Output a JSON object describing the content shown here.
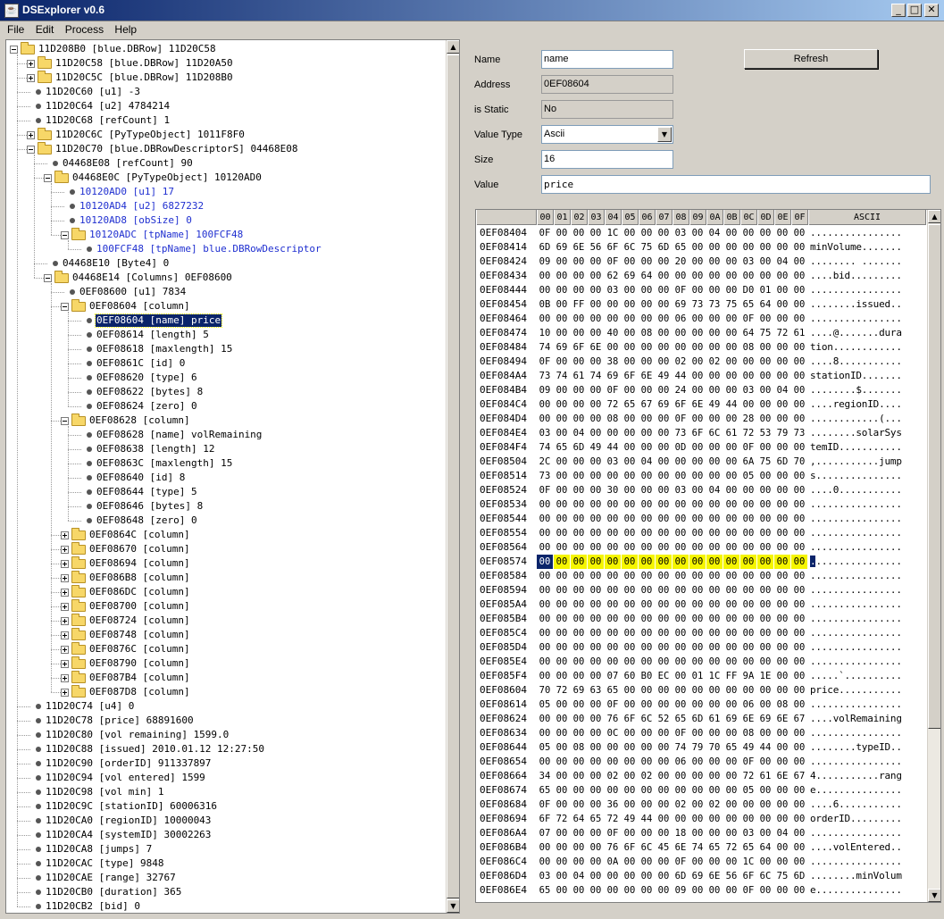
{
  "window": {
    "title": "DSExplorer v0.6",
    "minimize": "_",
    "maximize": "□",
    "close": "✕"
  },
  "menu": [
    "File",
    "Edit",
    "Process",
    "Help"
  ],
  "tree": [
    {
      "d": 0,
      "t": "f",
      "open": true,
      "label": "11D208B0 [blue.DBRow] 11D20C58"
    },
    {
      "d": 1,
      "t": "f",
      "open": false,
      "label": "11D20C58 [blue.DBRow] 11D20A50"
    },
    {
      "d": 1,
      "t": "f",
      "open": false,
      "label": "11D20C5C [blue.DBRow] 11D208B0"
    },
    {
      "d": 1,
      "t": "l",
      "label": "11D20C60 [u1] -3"
    },
    {
      "d": 1,
      "t": "l",
      "label": "11D20C64 [u2] 4784214"
    },
    {
      "d": 1,
      "t": "l",
      "label": "11D20C68 [refCount] 1"
    },
    {
      "d": 1,
      "t": "f",
      "open": false,
      "label": "11D20C6C [PyTypeObject] 1011F8F0"
    },
    {
      "d": 1,
      "t": "f",
      "open": true,
      "label": "11D20C70 [blue.DBRowDescriptorS] 04468E08"
    },
    {
      "d": 2,
      "t": "l",
      "label": "04468E08 [refCount] 90"
    },
    {
      "d": 2,
      "t": "f",
      "open": true,
      "label": "04468E0C [PyTypeObject] 10120AD0"
    },
    {
      "d": 3,
      "t": "l",
      "blue": true,
      "label": "10120AD0 [u1] 17"
    },
    {
      "d": 3,
      "t": "l",
      "blue": true,
      "label": "10120AD4 [u2] 6827232"
    },
    {
      "d": 3,
      "t": "l",
      "blue": true,
      "label": "10120AD8 [obSize] 0"
    },
    {
      "d": 3,
      "t": "f",
      "open": true,
      "blue": true,
      "label": "10120ADC [tpName] 100FCF48"
    },
    {
      "d": 4,
      "t": "l",
      "blue": true,
      "label": "100FCF48 [tpName] blue.DBRowDescriptor"
    },
    {
      "d": 2,
      "t": "l",
      "label": "04468E10 [Byte4] 0"
    },
    {
      "d": 2,
      "t": "f",
      "open": true,
      "label": "04468E14 [Columns] 0EF08600"
    },
    {
      "d": 3,
      "t": "l",
      "label": "0EF08600 [u1] 7834"
    },
    {
      "d": 3,
      "t": "f",
      "open": true,
      "label": "0EF08604 [column]"
    },
    {
      "d": 4,
      "t": "l",
      "sel": true,
      "label": "0EF08604 [name] price"
    },
    {
      "d": 4,
      "t": "l",
      "label": "0EF08614 [length] 5"
    },
    {
      "d": 4,
      "t": "l",
      "label": "0EF08618 [maxlength] 15"
    },
    {
      "d": 4,
      "t": "l",
      "label": "0EF0861C [id] 0"
    },
    {
      "d": 4,
      "t": "l",
      "label": "0EF08620 [type] 6"
    },
    {
      "d": 4,
      "t": "l",
      "label": "0EF08622 [bytes] 8"
    },
    {
      "d": 4,
      "t": "l",
      "label": "0EF08624 [zero] 0"
    },
    {
      "d": 3,
      "t": "f",
      "open": true,
      "label": "0EF08628 [column]"
    },
    {
      "d": 4,
      "t": "l",
      "label": "0EF08628 [name] volRemaining"
    },
    {
      "d": 4,
      "t": "l",
      "label": "0EF08638 [length] 12"
    },
    {
      "d": 4,
      "t": "l",
      "label": "0EF0863C [maxlength] 15"
    },
    {
      "d": 4,
      "t": "l",
      "label": "0EF08640 [id] 8"
    },
    {
      "d": 4,
      "t": "l",
      "label": "0EF08644 [type] 5"
    },
    {
      "d": 4,
      "t": "l",
      "label": "0EF08646 [bytes] 8"
    },
    {
      "d": 4,
      "t": "l",
      "label": "0EF08648 [zero] 0"
    },
    {
      "d": 3,
      "t": "f",
      "open": false,
      "label": "0EF0864C [column]"
    },
    {
      "d": 3,
      "t": "f",
      "open": false,
      "label": "0EF08670 [column]"
    },
    {
      "d": 3,
      "t": "f",
      "open": false,
      "label": "0EF08694 [column]"
    },
    {
      "d": 3,
      "t": "f",
      "open": false,
      "label": "0EF086B8 [column]"
    },
    {
      "d": 3,
      "t": "f",
      "open": false,
      "label": "0EF086DC [column]"
    },
    {
      "d": 3,
      "t": "f",
      "open": false,
      "label": "0EF08700 [column]"
    },
    {
      "d": 3,
      "t": "f",
      "open": false,
      "label": "0EF08724 [column]"
    },
    {
      "d": 3,
      "t": "f",
      "open": false,
      "label": "0EF08748 [column]"
    },
    {
      "d": 3,
      "t": "f",
      "open": false,
      "label": "0EF0876C [column]"
    },
    {
      "d": 3,
      "t": "f",
      "open": false,
      "label": "0EF08790 [column]"
    },
    {
      "d": 3,
      "t": "f",
      "open": false,
      "label": "0EF087B4 [column]"
    },
    {
      "d": 3,
      "t": "f",
      "open": false,
      "label": "0EF087D8 [column]"
    },
    {
      "d": 1,
      "t": "l",
      "label": "11D20C74 [u4] 0"
    },
    {
      "d": 1,
      "t": "l",
      "label": "11D20C78 [price] 68891600"
    },
    {
      "d": 1,
      "t": "l",
      "label": "11D20C80 [vol remaining] 1599.0"
    },
    {
      "d": 1,
      "t": "l",
      "label": "11D20C88 [issued] 2010.01.12 12:27:50"
    },
    {
      "d": 1,
      "t": "l",
      "label": "11D20C90 [orderID] 911337897"
    },
    {
      "d": 1,
      "t": "l",
      "label": "11D20C94 [vol entered] 1599"
    },
    {
      "d": 1,
      "t": "l",
      "label": "11D20C98 [vol min] 1"
    },
    {
      "d": 1,
      "t": "l",
      "label": "11D20C9C [stationID] 60006316"
    },
    {
      "d": 1,
      "t": "l",
      "label": "11D20CA0 [regionID] 10000043"
    },
    {
      "d": 1,
      "t": "l",
      "label": "11D20CA4 [systemID] 30002263"
    },
    {
      "d": 1,
      "t": "l",
      "label": "11D20CA8 [jumps] 7"
    },
    {
      "d": 1,
      "t": "l",
      "label": "11D20CAC [type] 9848"
    },
    {
      "d": 1,
      "t": "l",
      "label": "11D20CAE [range] 32767"
    },
    {
      "d": 1,
      "t": "l",
      "label": "11D20CB0 [duration] 365"
    },
    {
      "d": 1,
      "t": "l",
      "label": "11D20CB2 [bid] 0"
    }
  ],
  "props": {
    "name_label": "Name",
    "name_value": "name",
    "address_label": "Address",
    "address_value": "0EF08604",
    "static_label": "is Static",
    "static_value": "No",
    "type_label": "Value Type",
    "type_value": "Ascii",
    "size_label": "Size",
    "size_value": "16",
    "value_label": "Value",
    "value_value": "price",
    "refresh_label": "Refresh"
  },
  "hex": {
    "columns": [
      "00",
      "01",
      "02",
      "03",
      "04",
      "05",
      "06",
      "07",
      "08",
      "09",
      "0A",
      "0B",
      "0C",
      "0D",
      "0E",
      "0F"
    ],
    "ascii_header": "ASCII",
    "selected_row": 23,
    "highlight_len": 16,
    "rows": [
      {
        "addr": "0EF08404",
        "bytes": "0F 00 00 00 1C 00 00 00 03 00 04 00 00 00 00 00",
        "ascii": "................"
      },
      {
        "addr": "0EF08414",
        "bytes": "6D 69 6E 56 6F 6C 75 6D 65 00 00 00 00 00 00 00",
        "ascii": "minVolume......."
      },
      {
        "addr": "0EF08424",
        "bytes": "09 00 00 00 0F 00 00 00 20 00 00 00 03 00 04 00",
        "ascii": "........ ......."
      },
      {
        "addr": "0EF08434",
        "bytes": "00 00 00 00 62 69 64 00 00 00 00 00 00 00 00 00",
        "ascii": "....bid........."
      },
      {
        "addr": "0EF08444",
        "bytes": "00 00 00 00 03 00 00 00 0F 00 00 00 D0 01 00 00",
        "ascii": "................"
      },
      {
        "addr": "0EF08454",
        "bytes": "0B 00 FF 00 00 00 00 00 69 73 73 75 65 64 00 00",
        "ascii": "........issued.."
      },
      {
        "addr": "0EF08464",
        "bytes": "00 00 00 00 00 00 00 00 06 00 00 00 0F 00 00 00",
        "ascii": "................"
      },
      {
        "addr": "0EF08474",
        "bytes": "10 00 00 00 40 00 08 00 00 00 00 00 64 75 72 61",
        "ascii": "....@.......dura"
      },
      {
        "addr": "0EF08484",
        "bytes": "74 69 6F 6E 00 00 00 00 00 00 00 00 08 00 00 00",
        "ascii": "tion............"
      },
      {
        "addr": "0EF08494",
        "bytes": "0F 00 00 00 38 00 00 00 02 00 02 00 00 00 00 00",
        "ascii": "....8..........."
      },
      {
        "addr": "0EF084A4",
        "bytes": "73 74 61 74 69 6F 6E 49 44 00 00 00 00 00 00 00",
        "ascii": "stationID......."
      },
      {
        "addr": "0EF084B4",
        "bytes": "09 00 00 00 0F 00 00 00 24 00 00 00 03 00 04 00",
        "ascii": "........$......."
      },
      {
        "addr": "0EF084C4",
        "bytes": "00 00 00 00 72 65 67 69 6F 6E 49 44 00 00 00 00",
        "ascii": "....regionID...."
      },
      {
        "addr": "0EF084D4",
        "bytes": "00 00 00 00 08 00 00 00 0F 00 00 00 28 00 00 00",
        "ascii": "............(..."
      },
      {
        "addr": "0EF084E4",
        "bytes": "03 00 04 00 00 00 00 00 73 6F 6C 61 72 53 79 73",
        "ascii": "........solarSys"
      },
      {
        "addr": "0EF084F4",
        "bytes": "74 65 6D 49 44 00 00 00 0D 00 00 00 0F 00 00 00",
        "ascii": "temID..........."
      },
      {
        "addr": "0EF08504",
        "bytes": "2C 00 00 00 03 00 04 00 00 00 00 00 6A 75 6D 70",
        "ascii": ",...........jump"
      },
      {
        "addr": "0EF08514",
        "bytes": "73 00 00 00 00 00 00 00 00 00 00 00 05 00 00 00",
        "ascii": "s..............."
      },
      {
        "addr": "0EF08524",
        "bytes": "0F 00 00 00 30 00 00 00 03 00 04 00 00 00 00 00",
        "ascii": "....0..........."
      },
      {
        "addr": "0EF08534",
        "bytes": "00 00 00 00 00 00 00 00 00 00 00 00 00 00 00 00",
        "ascii": "................"
      },
      {
        "addr": "0EF08544",
        "bytes": "00 00 00 00 00 00 00 00 00 00 00 00 00 00 00 00",
        "ascii": "................"
      },
      {
        "addr": "0EF08554",
        "bytes": "00 00 00 00 00 00 00 00 00 00 00 00 00 00 00 00",
        "ascii": "................"
      },
      {
        "addr": "0EF08564",
        "bytes": "00 00 00 00 00 00 00 00 00 00 00 00 00 00 00 00",
        "ascii": "................"
      },
      {
        "addr": "0EF08574",
        "bytes": "00 00 00 00 00 00 00 00 00 00 00 00 00 00 00 00",
        "ascii": "................"
      },
      {
        "addr": "0EF08584",
        "bytes": "00 00 00 00 00 00 00 00 00 00 00 00 00 00 00 00",
        "ascii": "................"
      },
      {
        "addr": "0EF08594",
        "bytes": "00 00 00 00 00 00 00 00 00 00 00 00 00 00 00 00",
        "ascii": "................"
      },
      {
        "addr": "0EF085A4",
        "bytes": "00 00 00 00 00 00 00 00 00 00 00 00 00 00 00 00",
        "ascii": "................"
      },
      {
        "addr": "0EF085B4",
        "bytes": "00 00 00 00 00 00 00 00 00 00 00 00 00 00 00 00",
        "ascii": "................"
      },
      {
        "addr": "0EF085C4",
        "bytes": "00 00 00 00 00 00 00 00 00 00 00 00 00 00 00 00",
        "ascii": "................"
      },
      {
        "addr": "0EF085D4",
        "bytes": "00 00 00 00 00 00 00 00 00 00 00 00 00 00 00 00",
        "ascii": "................"
      },
      {
        "addr": "0EF085E4",
        "bytes": "00 00 00 00 00 00 00 00 00 00 00 00 00 00 00 00",
        "ascii": "................"
      },
      {
        "addr": "0EF085F4",
        "bytes": "00 00 00 00 07 60 B0 EC 00 01 1C FF 9A 1E 00 00",
        "ascii": ".....`.........."
      },
      {
        "addr": "0EF08604",
        "bytes": "70 72 69 63 65 00 00 00 00 00 00 00 00 00 00 00",
        "ascii": "price..........."
      },
      {
        "addr": "0EF08614",
        "bytes": "05 00 00 00 0F 00 00 00 00 00 00 00 06 00 08 00",
        "ascii": "................"
      },
      {
        "addr": "0EF08624",
        "bytes": "00 00 00 00 76 6F 6C 52 65 6D 61 69 6E 69 6E 67",
        "ascii": "....volRemaining"
      },
      {
        "addr": "0EF08634",
        "bytes": "00 00 00 00 0C 00 00 00 0F 00 00 00 08 00 00 00",
        "ascii": "................"
      },
      {
        "addr": "0EF08644",
        "bytes": "05 00 08 00 00 00 00 00 74 79 70 65 49 44 00 00",
        "ascii": "........typeID.."
      },
      {
        "addr": "0EF08654",
        "bytes": "00 00 00 00 00 00 00 00 06 00 00 00 0F 00 00 00",
        "ascii": "................"
      },
      {
        "addr": "0EF08664",
        "bytes": "34 00 00 00 02 00 02 00 00 00 00 00 72 61 6E 67",
        "ascii": "4...........rang"
      },
      {
        "addr": "0EF08674",
        "bytes": "65 00 00 00 00 00 00 00 00 00 00 00 05 00 00 00",
        "ascii": "e..............."
      },
      {
        "addr": "0EF08684",
        "bytes": "0F 00 00 00 36 00 00 00 02 00 02 00 00 00 00 00",
        "ascii": "....6..........."
      },
      {
        "addr": "0EF08694",
        "bytes": "6F 72 64 65 72 49 44 00 00 00 00 00 00 00 00 00",
        "ascii": "orderID........."
      },
      {
        "addr": "0EF086A4",
        "bytes": "07 00 00 00 0F 00 00 00 18 00 00 00 03 00 04 00",
        "ascii": "................"
      },
      {
        "addr": "0EF086B4",
        "bytes": "00 00 00 00 76 6F 6C 45 6E 74 65 72 65 64 00 00",
        "ascii": "....volEntered.."
      },
      {
        "addr": "0EF086C4",
        "bytes": "00 00 00 00 0A 00 00 00 0F 00 00 00 1C 00 00 00",
        "ascii": "................"
      },
      {
        "addr": "0EF086D4",
        "bytes": "03 00 04 00 00 00 00 00 6D 69 6E 56 6F 6C 75 6D",
        "ascii": "........minVolum"
      },
      {
        "addr": "0EF086E4",
        "bytes": "65 00 00 00 00 00 00 00 09 00 00 00 0F 00 00 00",
        "ascii": "e..............."
      }
    ]
  }
}
